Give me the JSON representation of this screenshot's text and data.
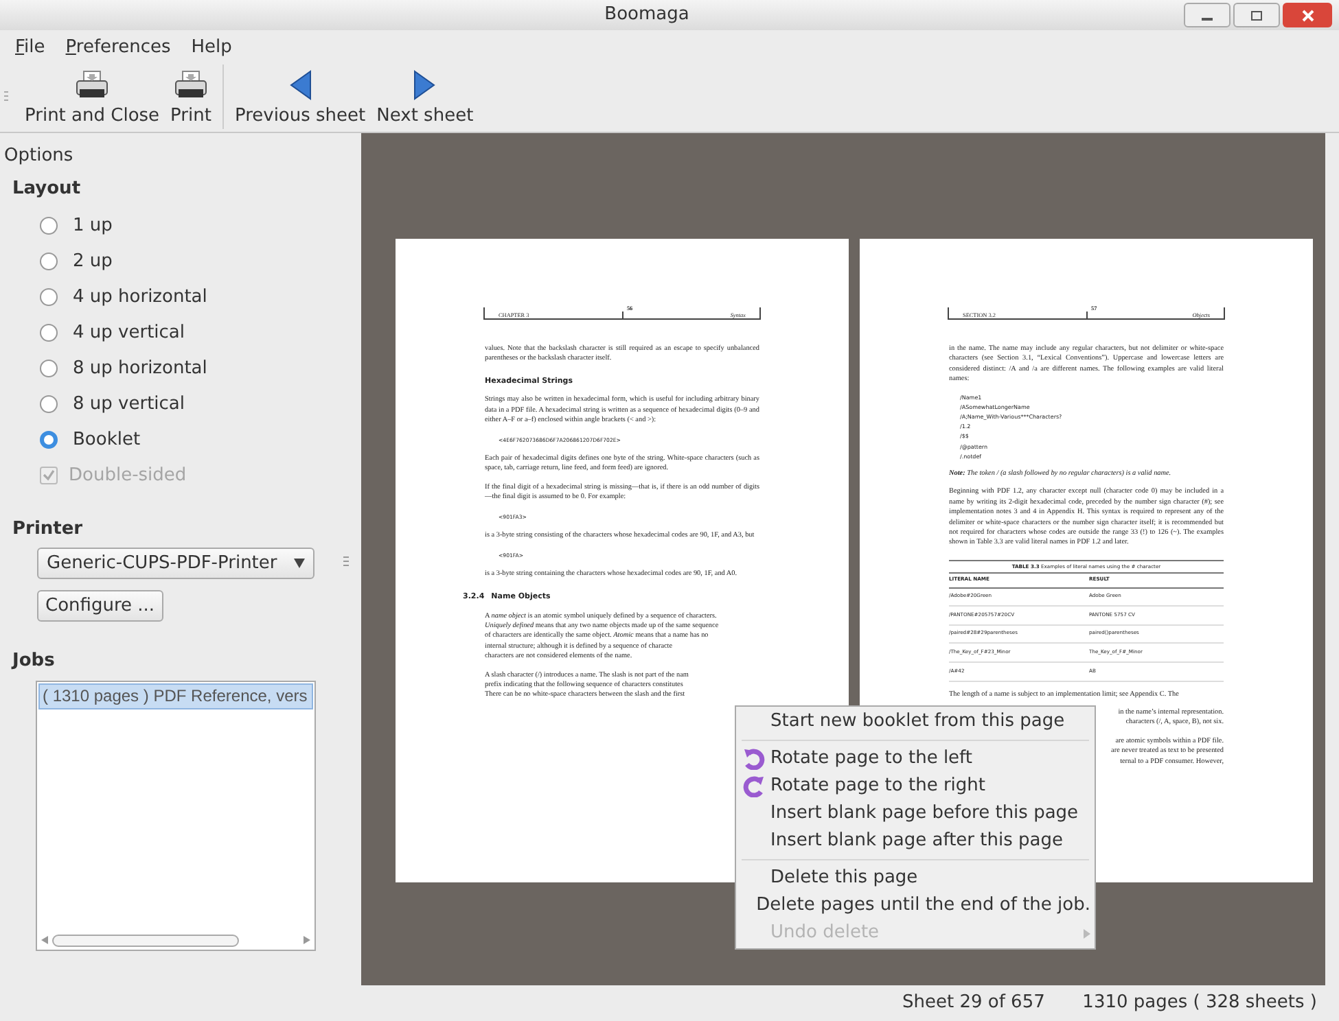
{
  "window": {
    "title": "Boomaga"
  },
  "menu_bar": [
    {
      "label": "File",
      "mnemonic": true
    },
    {
      "label": "Preferences",
      "mnemonic": true
    },
    {
      "label": "Help",
      "mnemonic": false
    }
  ],
  "toolbar": [
    [
      {
        "label": "Print and Close",
        "kind": "printer"
      },
      {
        "label": "Print",
        "kind": "printer"
      }
    ],
    [
      {
        "label": "Previous sheet",
        "kind": "previous"
      },
      {
        "label": "Next sheet",
        "kind": "next"
      }
    ]
  ],
  "sidebar": {
    "title": "Options",
    "layout": {
      "title": "Layout",
      "options": [
        {
          "label": "1 up",
          "selected": false
        },
        {
          "label": "2 up",
          "selected": false
        },
        {
          "label": "4 up horizontal",
          "selected": false
        },
        {
          "label": "4 up vertical",
          "selected": false
        },
        {
          "label": "8 up horizontal",
          "selected": false
        },
        {
          "label": "8 up vertical",
          "selected": false
        },
        {
          "label": "Booklet",
          "selected": true
        }
      ],
      "double_sided": {
        "label": "Double-sided",
        "checked": true,
        "disabled": true
      }
    },
    "printer": {
      "title": "Printer",
      "value": "Generic-CUPS-PDF-Printer",
      "configure": "Configure ..."
    },
    "jobs": {
      "title": "Jobs",
      "items": [
        {
          "label": "( 1310 pages ) PDF Reference, vers",
          "selected": true
        }
      ]
    }
  },
  "pages": [
    {
      "header_left": "CHAPTER 3",
      "number": "56",
      "header_right": "Syntax",
      "blocks": [
        {
          "kind": "p",
          "text": "values. Note that the backslash character is still required as an escape to specify unbalanced parentheses or the backslash character itself."
        },
        {
          "kind": "h",
          "text": "Hexadecimal Strings"
        },
        {
          "kind": "p",
          "text": "Strings may also be written in hexadecimal form, which is useful for including arbitrary binary data in a PDF file. A hexadecimal string is written as a sequence of hexadecimal digits (0–9 and either A–F or a–f) enclosed within angle brackets (< and >):"
        },
        {
          "kind": "code",
          "text": "<4E6F762073686D6F7A206861207D6F702E>"
        },
        {
          "kind": "p",
          "text": "Each pair of hexadecimal digits defines one byte of the string. White-space characters (such as space, tab, carriage return, line feed, and form feed) are ignored."
        },
        {
          "kind": "p",
          "text": "If the final digit of a hexadecimal string is missing—that is, if there is an odd number of digits—the final digit is assumed to be 0. For example:"
        },
        {
          "kind": "code",
          "text": "<901FA3>"
        },
        {
          "kind": "p",
          "text": "is a 3-byte string consisting of the characters whose hexadecimal codes are 90, 1F, and A3, but"
        },
        {
          "kind": "code",
          "text": "<901FA>"
        },
        {
          "kind": "p",
          "text": "is a 3-byte string containing the characters whose hexadecimal codes are 90, 1F, and A0."
        },
        {
          "kind": "section",
          "number": "3.2.4",
          "text": "Name Objects"
        },
        {
          "kind": "lines",
          "lines": [
            "A *name object* is an atomic symbol uniquely defined by a sequence of characters.",
            "*Uniquely defined* means that any two name objects made up of the same sequence",
            "of characters are identically the same object. *Atomic* means that a name has no",
            "internal structure; although it is defined by a sequence of characte",
            "characters are not considered elements of the name."
          ]
        },
        {
          "kind": "lines",
          "lines": [
            "A slash character (/) introduces a name. The slash is not part of the nam",
            "prefix indicating that the following sequence of characters constitutes",
            "There can be no white-space characters between the slash and the first"
          ]
        }
      ]
    },
    {
      "header_left": "SECTION 3.2",
      "number": "57",
      "header_right": "Objects",
      "blocks": [
        {
          "kind": "p",
          "text": "in the name. The name may include any regular characters, but not delimiter or white-space characters (see Section 3.1, “Lexical Conventions”). Uppercase and lowercase letters are considered distinct: /A and /a are different names. The following examples are valid literal names:"
        },
        {
          "kind": "list",
          "lines": [
            "/Name1",
            "/ASomewhatLongerName",
            "/A;Name_With-Various***Characters?",
            "/1.2",
            "/$$",
            "/@pattern",
            "/.notdef"
          ]
        },
        {
          "kind": "note",
          "text": "**Note:** The token / (a slash followed by no regular characters) is a valid name."
        },
        {
          "kind": "p",
          "text": "Beginning with PDF 1.2, any character except null (character code 0) may be included in a name by writing its 2-digit hexadecimal code, preceded by the number sign character (#); see implementation notes 3 and 4 in Appendix H. This syntax is required to represent any of the delimiter or white-space characters or the number sign character itself; it is recommended but not required for characters whose codes are outside the range 33 (!) to 126 (~). The examples shown in Table 3.3 are valid literal names in PDF 1.2 and later."
        },
        {
          "kind": "table",
          "title": "**TABLE 3.3** Examples of literal names using the # character",
          "columns": [
            "LITERAL NAME",
            "RESULT"
          ],
          "rows": [
            [
              "/Adobe#20Green",
              "Adobe Green"
            ],
            [
              "/PANTONE#205757#20CV",
              "PANTONE 5757 CV"
            ],
            [
              "/paired#28#29parentheses",
              "paired()parentheses"
            ],
            [
              "/The_Key_of_F#23_Minor",
              "The_Key_of_F#_Minor"
            ],
            [
              "/A#42",
              "AB"
            ]
          ]
        },
        {
          "kind": "lines",
          "lines": [
            "The length of a name is subject to an implementation limit; see Appendix C. The"
          ]
        },
        {
          "kind": "fragments",
          "lines": [
            "in the name’s internal representation.",
            "characters (/, A, space, B), not six."
          ]
        },
        {
          "kind": "fragments",
          "lines": [
            "are atomic symbols within a PDF file.",
            "are never treated as text to be presented",
            "ternal to a PDF consumer. However,"
          ]
        }
      ]
    }
  ],
  "context_menu": [
    {
      "kind": "item",
      "label": "Start new booklet from this page",
      "disabled": false,
      "submenu": false
    },
    {
      "kind": "separator"
    },
    {
      "kind": "rotateleft",
      "label": "Rotate page to the left",
      "disabled": false,
      "submenu": false
    },
    {
      "kind": "rotateright",
      "label": "Rotate page to the right",
      "disabled": false,
      "submenu": false
    },
    {
      "kind": "item",
      "label": "Insert blank page before this page",
      "disabled": false,
      "submenu": false
    },
    {
      "kind": "item",
      "label": "Insert blank page after this page",
      "disabled": false,
      "submenu": false
    },
    {
      "kind": "separator"
    },
    {
      "kind": "item",
      "label": "Delete this page",
      "disabled": false,
      "submenu": false
    },
    {
      "kind": "item",
      "label": "Delete pages until the end of the job.",
      "disabled": false,
      "submenu": false
    },
    {
      "kind": "item",
      "label": "Undo delete",
      "disabled": true,
      "submenu": true
    }
  ],
  "status_bar": {
    "sheet": "Sheet 29 of 657",
    "pages": "1310 pages ( 328 sheets )"
  }
}
